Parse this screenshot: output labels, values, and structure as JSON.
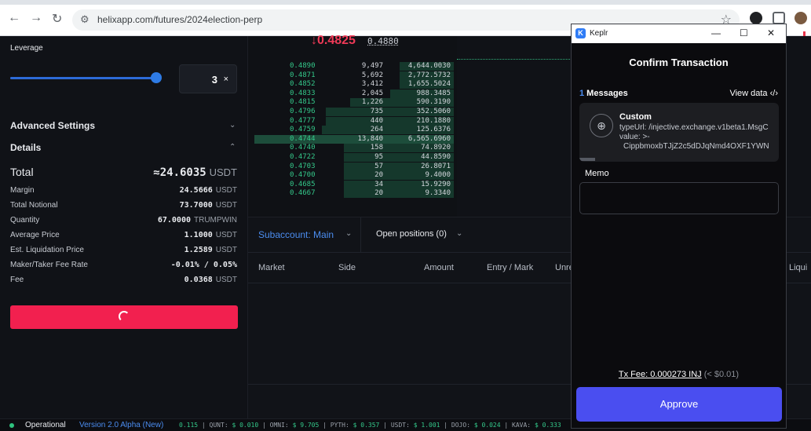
{
  "browser": {
    "url": "helixapp.com/futures/2024election-perp"
  },
  "order_panel": {
    "leverage_label": "Leverage",
    "leverage_value": "3",
    "leverage_suffix": "×",
    "leverage_fraction": 0.97,
    "advanced_settings": "Advanced Settings",
    "details": "Details",
    "total_label": "Total",
    "total_value": "≈24.6035",
    "total_unit": "USDT",
    "rows": [
      {
        "label": "Margin",
        "value": "24.5666",
        "unit": "USDT"
      },
      {
        "label": "Total Notional",
        "value": "73.7000",
        "unit": "USDT"
      },
      {
        "label": "Quantity",
        "value": "67.0000",
        "unit": "TRUMPWIN"
      },
      {
        "label": "Average Price",
        "value": "1.1000",
        "unit": "USDT"
      },
      {
        "label": "Est. Liquidation Price",
        "value": "1.2589",
        "unit": "USDT"
      },
      {
        "label": "Maker/Taker Fee Rate",
        "value": "-0.01% / 0.05%",
        "unit": ""
      },
      {
        "label": "Fee",
        "value": "0.0368",
        "unit": "USDT"
      }
    ]
  },
  "orderbook": {
    "mid_price": "↓0.4825",
    "mark_price": "0.4880",
    "rows": [
      {
        "price": "0.4890",
        "size": "9,497",
        "total": "4,644.0030",
        "depth": 0.27,
        "level": 0
      },
      {
        "price": "0.4871",
        "size": "5,692",
        "total": "2,772.5732",
        "depth": 0.27,
        "level": 0
      },
      {
        "price": "0.4852",
        "size": "3,412",
        "total": "1,655.5024",
        "depth": 0.27,
        "level": 0
      },
      {
        "price": "0.4833",
        "size": "2,045",
        "total": "988.3485",
        "depth": 0.32,
        "level": 0
      },
      {
        "price": "0.4815",
        "size": "1,226",
        "total": "590.3190",
        "depth": 0.52,
        "level": 0
      },
      {
        "price": "0.4796",
        "size": "735",
        "total": "352.5060",
        "depth": 0.64,
        "level": 0
      },
      {
        "price": "0.4777",
        "size": "440",
        "total": "210.1880",
        "depth": 0.64,
        "level": 0
      },
      {
        "price": "0.4759",
        "size": "264",
        "total": "125.6376",
        "depth": 0.66,
        "level": 0
      },
      {
        "price": "0.4744",
        "size": "13,840",
        "total": "6,565.6960",
        "depth": 1.0,
        "level": 1
      },
      {
        "price": "0.4740",
        "size": "158",
        "total": "74.8920",
        "depth": 0.55,
        "level": 0
      },
      {
        "price": "0.4722",
        "size": "95",
        "total": "44.8590",
        "depth": 0.55,
        "level": 0
      },
      {
        "price": "0.4703",
        "size": "57",
        "total": "26.8071",
        "depth": 0.55,
        "level": 0
      },
      {
        "price": "0.4700",
        "size": "20",
        "total": "9.4000",
        "depth": 0.55,
        "level": 0
      },
      {
        "price": "0.4685",
        "size": "34",
        "total": "15.9290",
        "depth": 0.55,
        "level": 0
      },
      {
        "price": "0.4667",
        "size": "20",
        "total": "9.3340",
        "depth": 0.55,
        "level": 0
      }
    ]
  },
  "positions": {
    "subaccount": "Subaccount: Main",
    "open_positions": "Open positions (0)",
    "columns": [
      "Market",
      "Side",
      "Amount",
      "Entry / Mark",
      "Unre",
      "Liqui"
    ]
  },
  "statusbar": {
    "status": "Operational",
    "version": "Version 2.0 Alpha (New)",
    "ticker": [
      {
        "sym": "",
        "val": "0.115"
      },
      {
        "sym": "QUNT:",
        "val": "$ 0.010"
      },
      {
        "sym": "OMNI:",
        "val": "$ 9.705"
      },
      {
        "sym": "PYTH:",
        "val": "$ 0.357"
      },
      {
        "sym": "USDT:",
        "val": "$ 1.001"
      },
      {
        "sym": "DOJO:",
        "val": "$ 0.024"
      },
      {
        "sym": "KAVA:",
        "val": "$ 0.333"
      }
    ]
  },
  "keplr": {
    "app_name": "Keplr",
    "heading": "Confirm Transaction",
    "message_count": "1",
    "messages_label": " Messages",
    "view_data": "View data ‹/›",
    "msg_title": "Custom",
    "msg_line1": "typeUrl: /injective.exchange.v1beta1.MsgC",
    "msg_line2": "value: >-",
    "msg_line3": "CippbmoxbTJjZ2c5dDJqNmd4OXF1YWN",
    "memo_label": "Memo",
    "fee_label": "Tx Fee: 0.000273 INJ",
    "fee_usd": " (< $0.01)",
    "approve": "Approve"
  },
  "colors": {
    "accent_blue": "#4b8df0",
    "bid_green": "#34c88a",
    "ask_red": "#ee3a57",
    "submit_red": "#f2204f",
    "approve_violet": "#4a4ef0"
  }
}
